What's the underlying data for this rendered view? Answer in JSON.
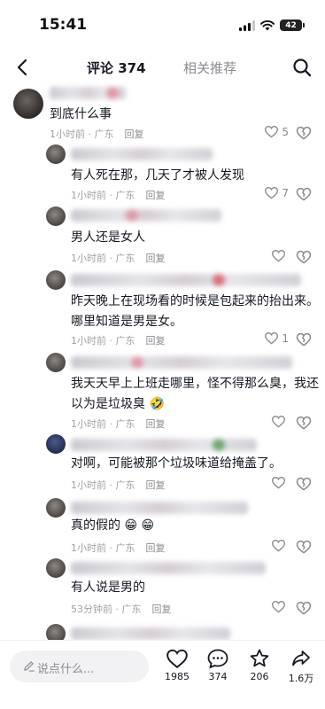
{
  "status": {
    "time": "15:41",
    "battery": "42"
  },
  "header": {
    "tab_comments": "评论 374",
    "tab_related": "相关推荐"
  },
  "comments": [
    {
      "text": "到底什么事",
      "time": "1小时前 · 广东",
      "reply": "回复",
      "likes": "5"
    },
    {
      "text": "有人死在那，几天了才被人发现",
      "time": "1小时前 · 广东",
      "reply": "回复",
      "likes": "7"
    },
    {
      "text": "男人还是女人",
      "time": "1小时前 · 广东",
      "reply": "回复",
      "likes": ""
    },
    {
      "text_line1": "昨天晚上在现场看的时候是包起来的抬出来。",
      "text_line2": "哪里知道是男是女。",
      "time": "1小时前 · 广东",
      "reply": "回复",
      "likes": "1"
    },
    {
      "text_line1": "我天天早上上班走哪里，怪不得那么臭，我还",
      "text_line2": "以为是垃圾臭",
      "emoji": "🤣",
      "time": "1小时前 · 广东",
      "reply": "回复",
      "likes": ""
    },
    {
      "text": "对啊，可能被那个垃圾味道给掩盖了。",
      "time": "1小时前 · 广东",
      "reply": "回复",
      "likes": ""
    },
    {
      "text": "真的假的",
      "emoji": "😁 😁",
      "time": "1小时前 · 广东",
      "reply": "回复",
      "likes": ""
    },
    {
      "text": "有人说是男的",
      "time": "53分钟前 · 广东",
      "reply": "回复",
      "likes": ""
    }
  ],
  "bottom": {
    "placeholder": "说点什么...",
    "likes": "1985",
    "comments": "374",
    "favorites": "206",
    "shares": "1.6万"
  }
}
